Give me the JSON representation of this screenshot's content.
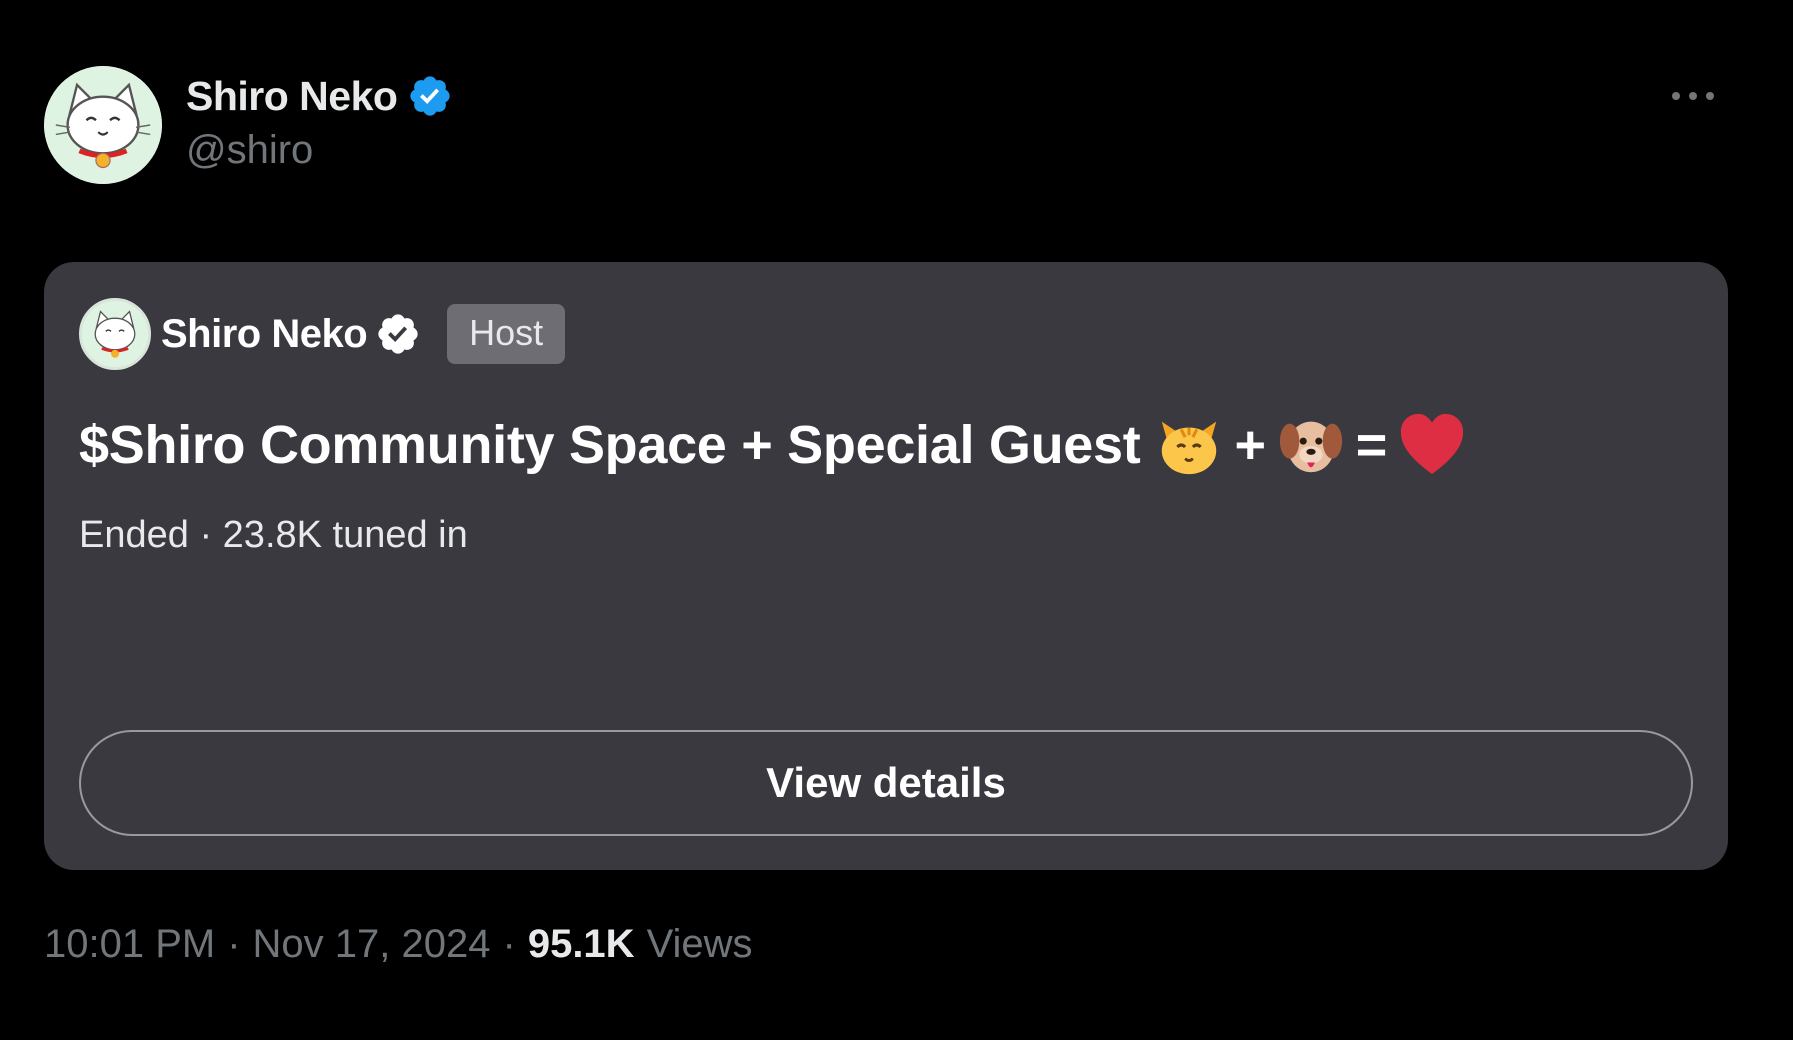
{
  "author": {
    "display_name": "Shiro Neko",
    "handle": "@shiro",
    "verified": true,
    "avatar_icon": "white-cat-avatar-icon",
    "badge_color": "#1d9bf0"
  },
  "more_icon": "more-horizontal-icon",
  "space_card": {
    "host_name": "Shiro Neko",
    "host_tag": "Host",
    "title_text": "$Shiro Community Space + Special Guest",
    "title_emojis": [
      "cat-face-emoji",
      "+",
      "dog-face-emoji",
      "=",
      "red-heart-emoji"
    ],
    "status": "Ended",
    "separator": "·",
    "tuned_in": "23.8K tuned in",
    "button_label": "View details",
    "background_color": "#3a3940"
  },
  "meta": {
    "time": "10:01 PM",
    "date": "Nov 17, 2024",
    "separator": "·",
    "views_count": "95.1K",
    "views_label": "Views"
  }
}
